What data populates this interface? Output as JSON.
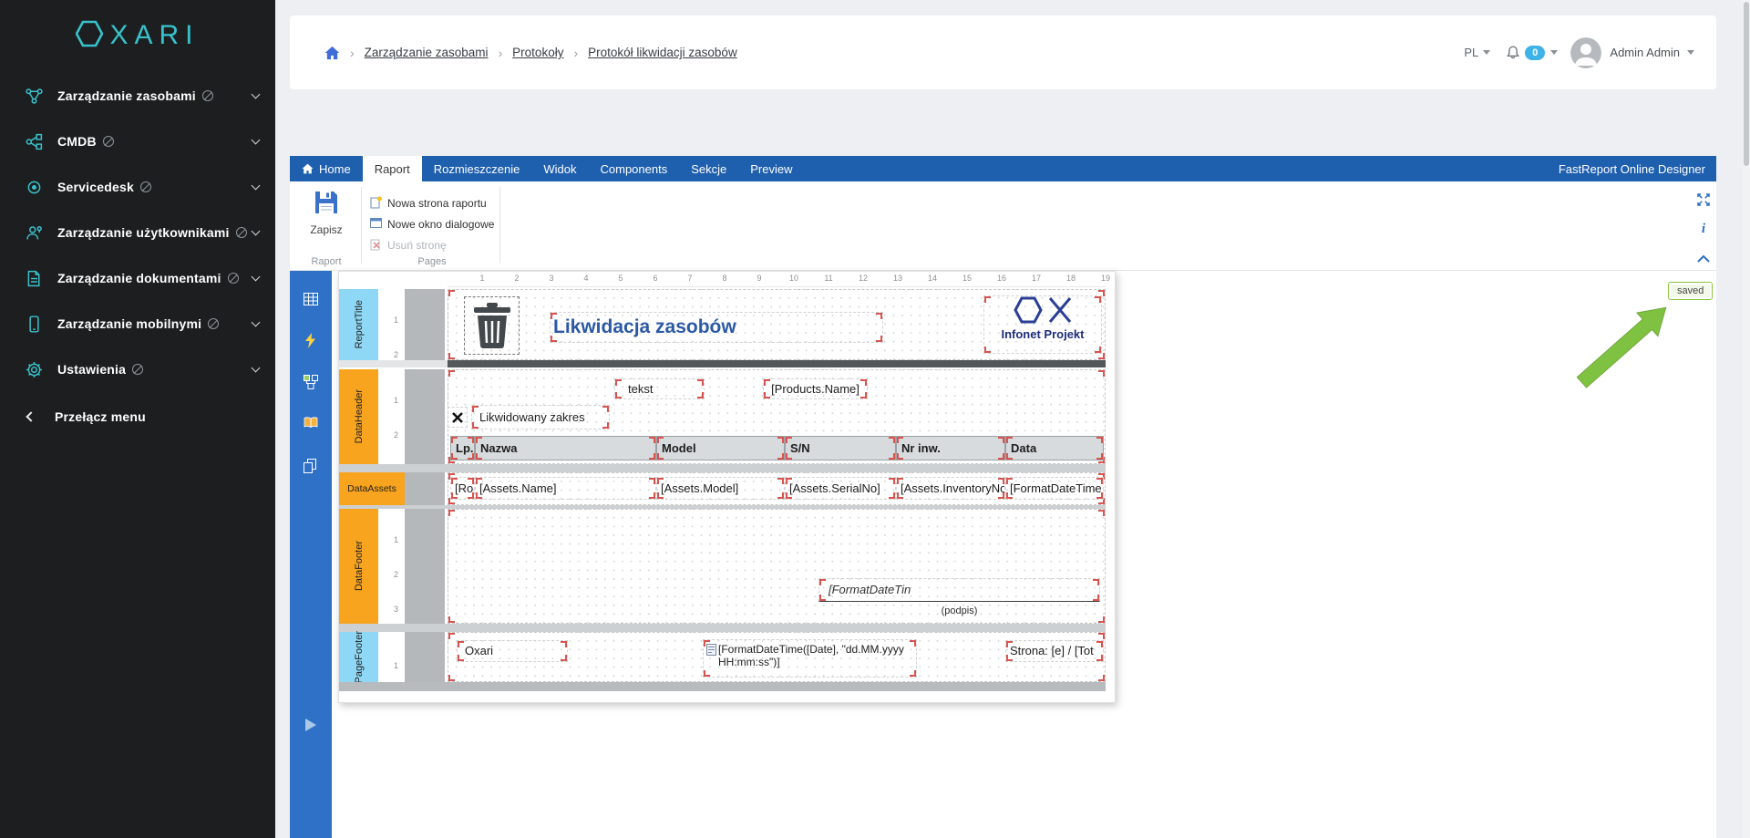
{
  "sidebar": {
    "logo_text": "XARI",
    "items": [
      {
        "label": "Zarządzanie zasobami"
      },
      {
        "label": "CMDB"
      },
      {
        "label": "Servicedesk"
      },
      {
        "label": "Zarządzanie użytkownikami"
      },
      {
        "label": "Zarządzanie dokumentami"
      },
      {
        "label": "Zarządzanie mobilnymi"
      },
      {
        "label": "Ustawienia"
      }
    ],
    "toggle_label": "Przełącz menu"
  },
  "header": {
    "breadcrumb": [
      "Zarządzanie zasobami",
      "Protokoły",
      "Protokół likwidacji zasobów"
    ],
    "language": "PL",
    "notification_count": "0",
    "user_name": "Admin Admin"
  },
  "designer": {
    "brand": "FastReport Online Designer",
    "tabs": [
      "Home",
      "Raport",
      "Rozmieszczenie",
      "Widok",
      "Components",
      "Sekcje",
      "Preview"
    ],
    "save_label": "Zapisz",
    "group_report": "Raport",
    "group_pages": "Pages",
    "page_actions": [
      "Nowa strona raportu",
      "Nowe okno dialogowe",
      "Usuń stronę"
    ],
    "saved_badge": "saved"
  },
  "canvas": {
    "hruler": [
      "1",
      "2",
      "3",
      "4",
      "5",
      "6",
      "7",
      "8",
      "9",
      "10",
      "11",
      "12",
      "13",
      "14",
      "15",
      "16",
      "17",
      "18",
      "19"
    ],
    "bands": {
      "report_title": {
        "name": "ReportTitle",
        "ticks": [
          "1",
          "2"
        ]
      },
      "data_header": {
        "name": "DataHeader",
        "ticks": [
          "1",
          "2"
        ]
      },
      "data_assets": {
        "name": "DataAssets"
      },
      "data_footer": {
        "name": "DataFooter",
        "ticks": [
          "1",
          "2",
          "3"
        ]
      },
      "page_footer": {
        "name": "PageFooter",
        "ticks": [
          "1"
        ]
      }
    },
    "report_title": {
      "title": "Likwidacja zasobów",
      "logo_caption": "Infonet Projekt"
    },
    "data_header": {
      "field_tekst": "tekst",
      "field_products": "[Products.Name]",
      "field_range": "Likwidowany zakres",
      "columns": [
        "Lp.",
        "Nazwa",
        "Model",
        "S/N",
        "Nr inw.",
        "Data"
      ]
    },
    "data_assets": {
      "cells": [
        "[Ro",
        "[Assets.Name]",
        "[Assets.Model]",
        "[Assets.SerialNo]",
        "[Assets.InventoryNo",
        "[FormatDateTime"
      ]
    },
    "data_footer": {
      "field_date": "[FormatDateTin",
      "signature_caption": "(podpis)"
    },
    "page_footer": {
      "left": "Oxari",
      "center_line1": "[FormatDateTime([Date], \"dd.MM.yyyy",
      "center_line2": "HH:mm:ss\")]",
      "right": "Strona: [e] / [Tot"
    }
  }
}
